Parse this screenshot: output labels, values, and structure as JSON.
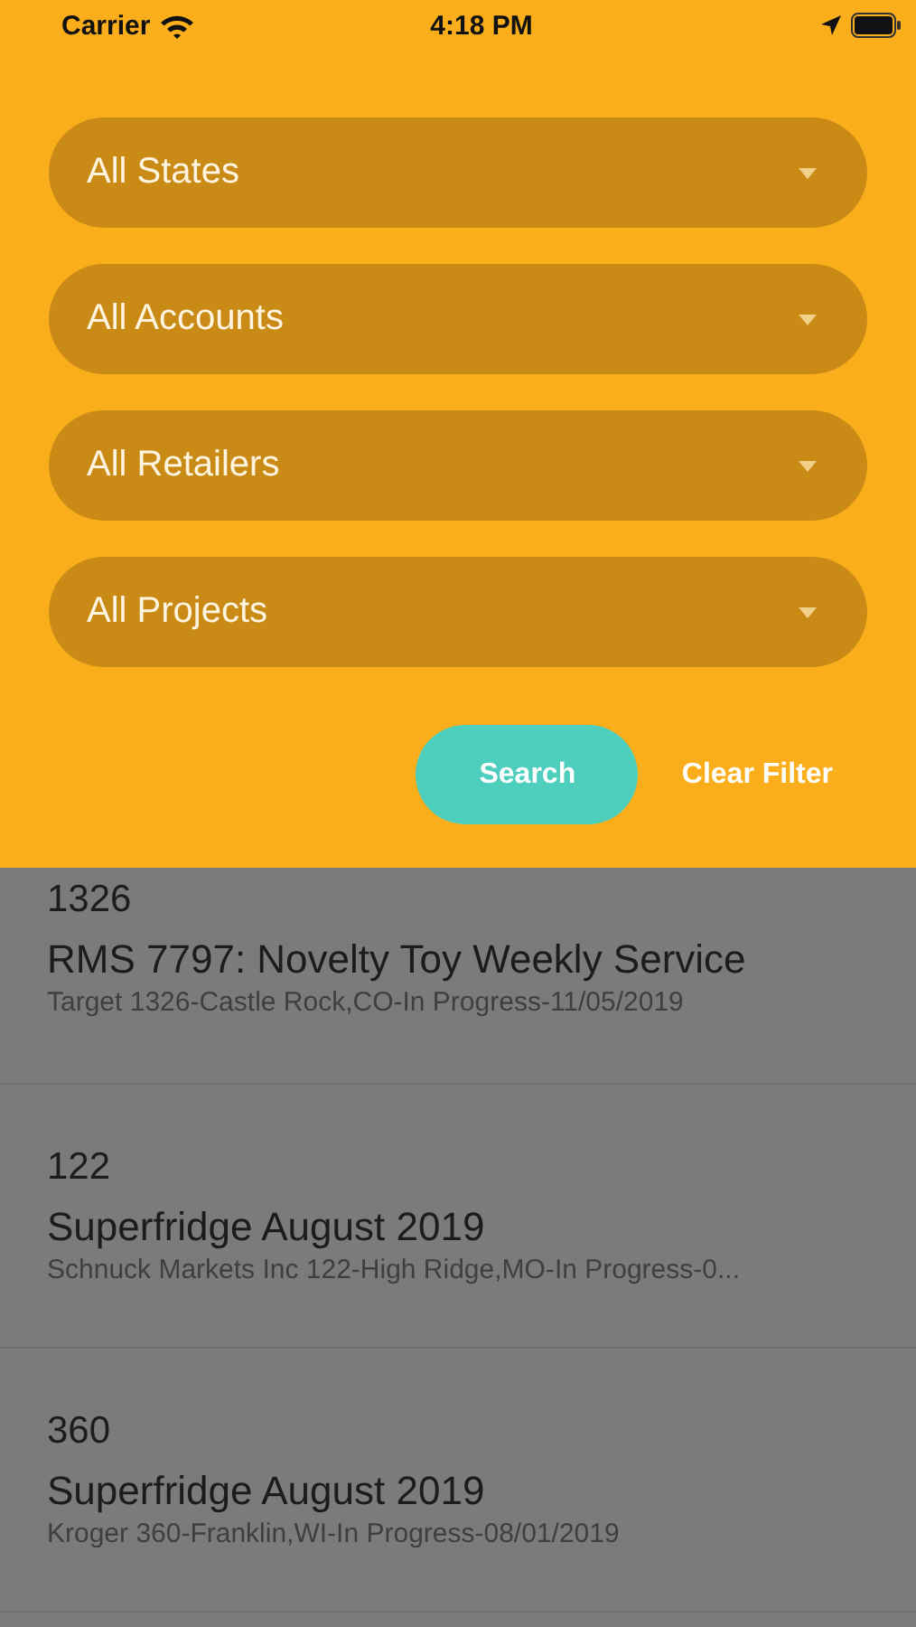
{
  "status_bar": {
    "carrier": "Carrier",
    "time": "4:18 PM"
  },
  "filters": [
    {
      "label": "All States"
    },
    {
      "label": "All Accounts"
    },
    {
      "label": "All Retailers"
    },
    {
      "label": "All Projects"
    }
  ],
  "buttons": {
    "search": "Search",
    "clear": "Clear Filter"
  },
  "results": [
    {
      "number": "1326",
      "title": "RMS 7797: Novelty Toy Weekly Service",
      "details": "Target 1326-Castle Rock,CO-In Progress-11/05/2019"
    },
    {
      "number": "122",
      "title": "Superfridge August 2019",
      "details": "Schnuck Markets Inc 122-High Ridge,MO-In Progress-0..."
    },
    {
      "number": "360",
      "title": "Superfridge August 2019",
      "details": "Kroger 360-Franklin,WI-In Progress-08/01/2019"
    }
  ]
}
